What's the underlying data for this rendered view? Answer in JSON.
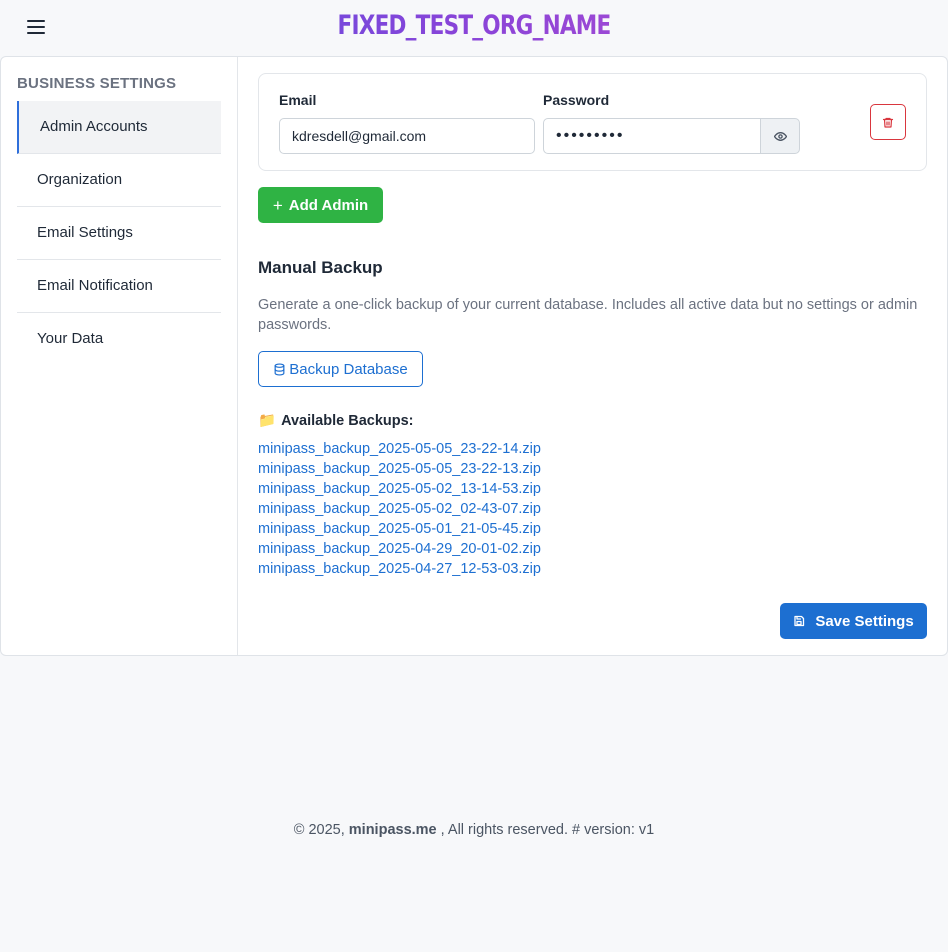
{
  "header": {
    "brand": "FIXED_TEST_ORG_NAME"
  },
  "sidebar": {
    "title": "BUSINESS SETTINGS",
    "items": [
      {
        "label": "Admin Accounts"
      },
      {
        "label": "Organization"
      },
      {
        "label": "Email Settings"
      },
      {
        "label": "Email Notification"
      },
      {
        "label": "Your Data"
      }
    ]
  },
  "admins": {
    "email_label": "Email",
    "password_label": "Password",
    "email_value": "kdresdell@gmail.com",
    "password_mask": "•••••••••",
    "add_label": "Add Admin"
  },
  "backup": {
    "title": "Manual Backup",
    "description": "Generate a one-click backup of your current database. Includes all active data but no settings or admin passwords.",
    "button_label": "Backup Database",
    "available_label": "Available Backups:",
    "files": [
      "minipass_backup_2025-05-05_23-22-14.zip",
      "minipass_backup_2025-05-05_23-22-13.zip",
      "minipass_backup_2025-05-02_13-14-53.zip",
      "minipass_backup_2025-05-02_02-43-07.zip",
      "minipass_backup_2025-05-01_21-05-45.zip",
      "minipass_backup_2025-04-29_20-01-02.zip",
      "minipass_backup_2025-04-27_12-53-03.zip"
    ]
  },
  "save_label": "Save Settings",
  "footer": {
    "prefix": "© 2025,",
    "brand": "minipass.me",
    "suffix": ", All rights reserved. # version: v1"
  },
  "colors": {
    "primary": "#1d6fd1",
    "success": "#2fb344",
    "danger": "#d9363e"
  }
}
